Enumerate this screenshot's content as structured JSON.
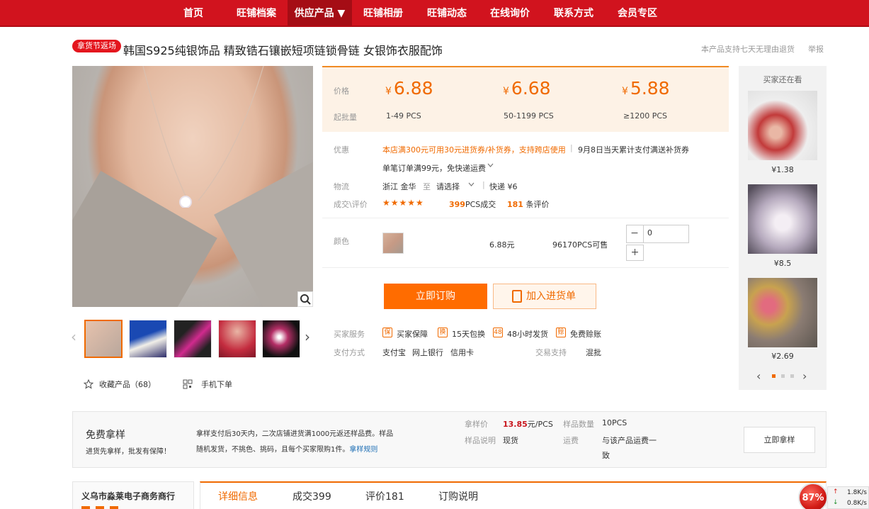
{
  "nav": {
    "items": [
      "首页",
      "旺铺档案",
      "供应产品 ▼",
      "旺铺相册",
      "旺铺动态",
      "在线询价",
      "联系方式",
      "会员专区"
    ],
    "active_index": 2,
    "color": "#d1131e"
  },
  "product": {
    "promo_tag": "拿货节返场",
    "title": "韩国S925纯银饰品 精致锆石镶嵌短项链锁骨链 女银饰衣服配饰",
    "return_note": "本产品支持七天无理由退货",
    "report": "举报"
  },
  "pricing": {
    "price_label": "价格",
    "moq_label": "起批量",
    "currency": "¥",
    "tiers": [
      {
        "price": "6.88",
        "range": "1-49 PCS"
      },
      {
        "price": "6.68",
        "range": "50-1199 PCS"
      },
      {
        "price": "5.88",
        "range": "≥1200 PCS"
      }
    ]
  },
  "promo": {
    "label": "优惠",
    "coupon": "本店满300元可用30元进货券/补货券，支持跨店使用",
    "sep": "|",
    "event": "9月8日当天累计支付满送补货券",
    "freeship": "单笔订单满99元，免快递运费",
    "chevron": "chevron-down-icon"
  },
  "logistics": {
    "label": "物流",
    "origin": "浙江 金华",
    "to": "至",
    "dest": "请选择",
    "sep": "|",
    "fee": "快递 ¥6"
  },
  "reviews": {
    "label": "成交\\评价",
    "stars": "★★★★★",
    "deals_num": "399",
    "deals_text": "PCS成交",
    "reviews_num": "181",
    "reviews_text": "条评价"
  },
  "color_option": {
    "label": "颜色",
    "price": "6.88元",
    "stock": "96170PCS可售",
    "qty": "0",
    "minus": "−",
    "plus": "+"
  },
  "actions": {
    "buy": "立即订购",
    "cart": "加入进货单"
  },
  "services": {
    "label": "买家服务",
    "items": [
      "买家保障",
      "15天包换",
      "48小时发货",
      "免费赊账"
    ],
    "pay_label": "支付方式",
    "pay_methods": [
      "支付宝",
      "网上银行",
      "信用卡"
    ],
    "trade_label": "交易支持",
    "trade_value": "混批"
  },
  "gallery": {
    "favorite": "收藏产品（68）",
    "mobile": "手机下单",
    "prev": "‹",
    "next": "›"
  },
  "sidebar": {
    "title": "买家还在看",
    "items": [
      {
        "price": "¥1.38"
      },
      {
        "price": "¥8.5"
      },
      {
        "price": "¥2.69"
      }
    ],
    "prev": "‹",
    "next": "›"
  },
  "sample": {
    "title": "免费拿样",
    "subtitle": "进货先拿样，批发有保障！",
    "desc_line1": "拿样支付后30天内，二次店铺进货满1000元返还样品费。样品",
    "desc_line2": "随机发货，不挑色、挑码，且每个买家限购1件。",
    "rule_link": "拿样规则",
    "price_label": "拿样价",
    "price_value": "13.85",
    "price_unit": "元/PCS",
    "qty_label": "样品数量",
    "qty_value": "10PCS",
    "note_label": "样品说明",
    "note_value": "现货",
    "ship_label": "运费",
    "ship_value_1": "与该产品运费一",
    "ship_value_2": "致",
    "button": "立即拿样"
  },
  "shop": {
    "name": "义乌市淼莱电子商务商行"
  },
  "tabs": [
    "详细信息",
    "成交399",
    "评价181",
    "订购说明"
  ],
  "net_widget": {
    "percent": "87%",
    "up": "1.8K/s",
    "down": "0.8K/s"
  }
}
